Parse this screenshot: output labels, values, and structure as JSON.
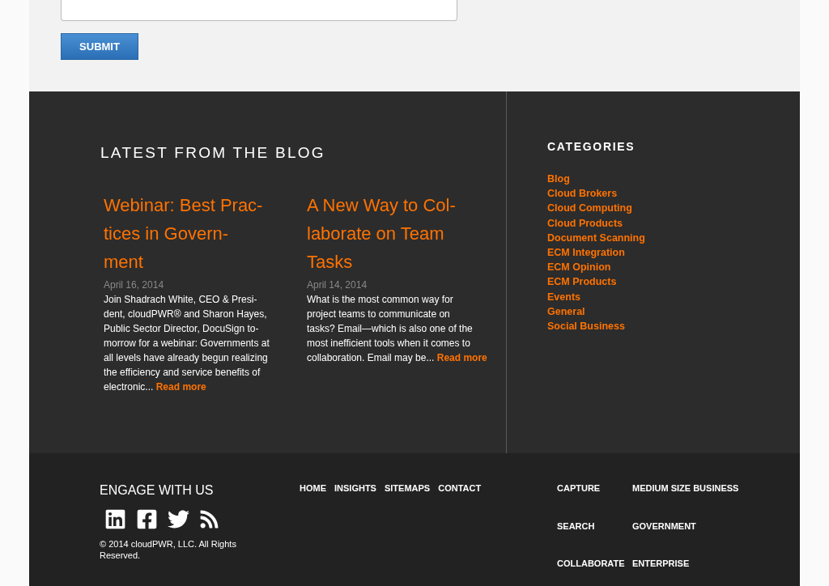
{
  "form": {
    "submit": "SUBMIT"
  },
  "blog": {
    "heading": "LATEST FROM THE BLOG",
    "posts": [
      {
        "title_lines": [
          "Webinar: Best Prac-",
          "tices in Govern-",
          "ment"
        ],
        "date": "April 16, 2014",
        "excerpt_lines": [
          "Join Shadrach White, CEO & Presi-",
          "dent, cloudPWR® and Sharon Hayes,",
          "Public Sector Director, DocuSign to-",
          "morrow for a webinar: Governments at",
          "all levels have already begun realizing",
          "the efficiency and service benefits of",
          "electronic..."
        ],
        "read_more": "Read more"
      },
      {
        "title_lines": [
          "A New Way to Col-",
          "laborate on Team",
          "Tasks"
        ],
        "date": "April 14, 2014",
        "excerpt_lines": [
          "What is the most common way for",
          "project teams to communicate on",
          "tasks? Email—which is also one of the",
          "most inefficient tools when it comes to",
          "collaboration. Email may be..."
        ],
        "read_more": "Read more"
      }
    ]
  },
  "categories": {
    "heading": "CATEGORIES",
    "items": [
      "Blog",
      "Cloud Brokers",
      "Cloud Computing",
      "Cloud Products",
      "Document Scanning",
      "ECM Integration",
      "ECM Opinion",
      "ECM Products",
      "Events",
      "General",
      "Social Business"
    ]
  },
  "footer": {
    "engage_heading": "ENGAGE WITH US",
    "social": [
      {
        "kind": "linkedin"
      },
      {
        "kind": "facebook"
      },
      {
        "kind": "twitter"
      },
      {
        "kind": "rss"
      }
    ],
    "copyright": "© 2014 cloudPWR, LLC. All Rights Reserved.",
    "nav": [
      "HOME",
      "INSIGHTS",
      "SITEMAPS",
      "CONTACT"
    ],
    "solutions": [
      "CAPTURE",
      "SEARCH",
      "COLLABORATE"
    ],
    "markets": [
      "MEDIUM SIZE BUSINESS",
      "GOVERNMENT",
      "ENTERPRISE"
    ]
  }
}
